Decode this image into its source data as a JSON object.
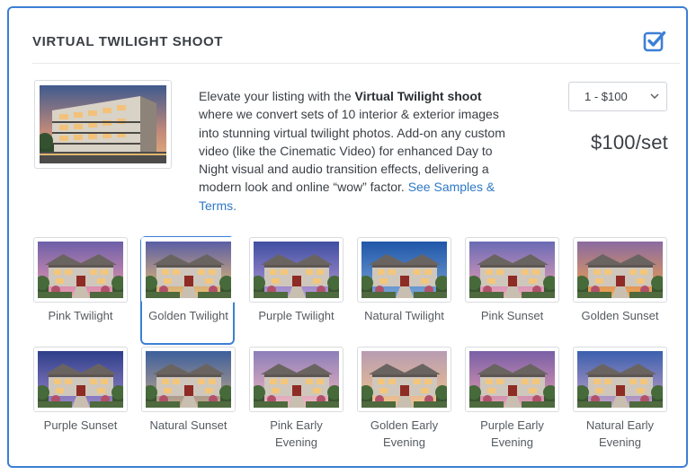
{
  "header": {
    "title": "VIRTUAL TWILIGHT SHOOT",
    "checked": true
  },
  "description": {
    "intro": "Elevate your listing with the ",
    "bold": "Virtual Twilight shoot",
    "body": " where we convert sets of 10 interior & exterior images into stunning virtual twilight photos. Add-on any custom video (like the Cinematic Video) for enhanced Day to Night visual and audio transition effects, delivering a modern look and online “wow” factor. ",
    "link": "See Samples & Terms."
  },
  "quantity_select": {
    "value": "1 - $100",
    "icon": "chevron-down-icon"
  },
  "price": "$100/set",
  "styles": [
    {
      "label": "Pink Twilight",
      "sky_top": "#6d5fa8",
      "sky_bottom": "#f29bb0",
      "selected": false
    },
    {
      "label": "Golden Twilight",
      "sky_top": "#5a5ea6",
      "sky_bottom": "#f6c46e",
      "selected": true
    },
    {
      "label": "Purple Twilight",
      "sky_top": "#3f4fa2",
      "sky_bottom": "#b79ad6",
      "selected": false
    },
    {
      "label": "Natural Twilight",
      "sky_top": "#1f56a8",
      "sky_bottom": "#7aa6d8",
      "selected": false
    },
    {
      "label": "Pink Sunset",
      "sky_top": "#6a6bb5",
      "sky_bottom": "#f3a2b8",
      "selected": false
    },
    {
      "label": "Golden Sunset",
      "sky_top": "#8a6aa0",
      "sky_bottom": "#f6a54a",
      "selected": false
    },
    {
      "label": "Purple Sunset",
      "sky_top": "#2e3f8a",
      "sky_bottom": "#9d88cc",
      "selected": false
    },
    {
      "label": "Natural Sunset",
      "sky_top": "#3d5f9c",
      "sky_bottom": "#c7a98a",
      "selected": false
    },
    {
      "label": "Pink Early Evening",
      "sky_top": "#8c7fb9",
      "sky_bottom": "#f4b7c0",
      "selected": false
    },
    {
      "label": "Golden Early Evening",
      "sky_top": "#b79cb2",
      "sky_bottom": "#f4c48a",
      "selected": false
    },
    {
      "label": "Purple Early Evening",
      "sky_top": "#7a5fa6",
      "sky_bottom": "#e79fb2",
      "selected": false
    },
    {
      "label": "Natural Early Evening",
      "sky_top": "#3b5fae",
      "sky_bottom": "#c6a2c8",
      "selected": false
    }
  ],
  "colors": {
    "accent": "#3c7fd6",
    "link": "#2f78c4",
    "text": "#3a3f45"
  }
}
